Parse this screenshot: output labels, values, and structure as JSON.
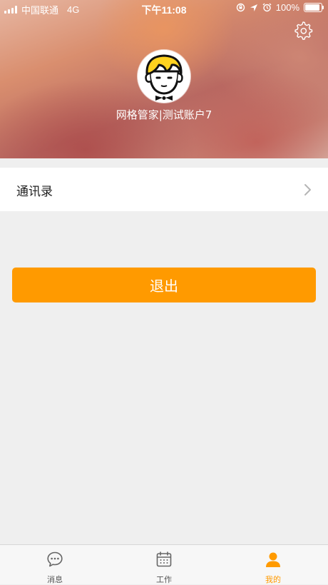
{
  "status_bar": {
    "carrier": "中国联通",
    "network": "4G",
    "time": "下午11:08",
    "battery": "100%",
    "battery_level": 1.0
  },
  "profile": {
    "username": "网格管家|测试账户7",
    "settings_icon": "gear-icon",
    "avatar_icon": "cartoon-avatar"
  },
  "menu": {
    "contacts_label": "通讯录"
  },
  "actions": {
    "logout_label": "退出"
  },
  "tabbar": {
    "tabs": [
      {
        "label": "消息",
        "icon": "chat-bubble-icon",
        "active": false
      },
      {
        "label": "工作",
        "icon": "calendar-icon",
        "active": false
      },
      {
        "label": "我的",
        "icon": "person-icon",
        "active": true
      }
    ]
  },
  "colors": {
    "accent": "#ff9a00",
    "background": "#efefef"
  }
}
